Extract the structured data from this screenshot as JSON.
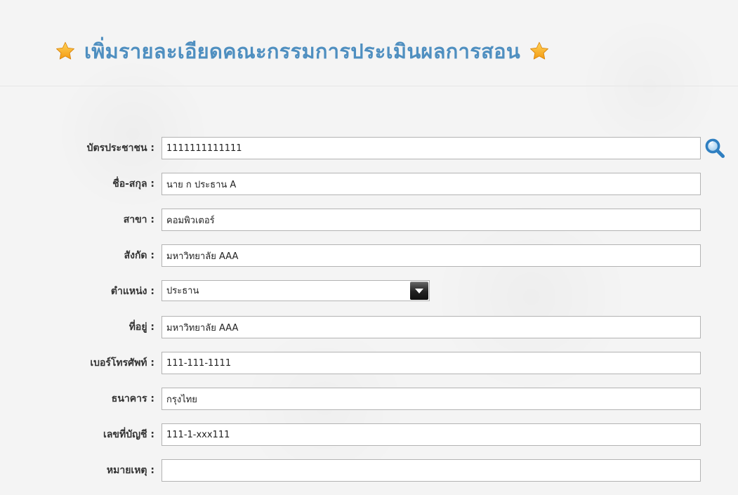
{
  "page": {
    "title": "เพิ่มรายละเอียดคณะกรรมการประเมินผลการสอน",
    "accent_color": "#4f8fc0",
    "star_color": "#f7a21b"
  },
  "form": {
    "fields": {
      "citizen_id": {
        "label": "บัตรประชาชน :",
        "value": "1111111111111"
      },
      "full_name": {
        "label": "ชื่อ-สกุล :",
        "value": "นาย ก ประธาน A"
      },
      "branch": {
        "label": "สาขา :",
        "value": "คอมพิวเตอร์"
      },
      "affiliation": {
        "label": "สังกัด :",
        "value": "มหาวิทยาลัย AAA"
      },
      "position": {
        "label": "ตำแหน่ง :",
        "value": "ประธาน"
      },
      "address": {
        "label": "ที่อยู่ :",
        "value": "มหาวิทยาลัย AAA"
      },
      "phone": {
        "label": "เบอร์โทรศัพท์ :",
        "value": "111-111-1111"
      },
      "bank": {
        "label": "ธนาคาร :",
        "value": "กรุงไทย"
      },
      "account_no": {
        "label": "เลขที่บัญชี :",
        "value": "111-1-xxx111"
      },
      "remarks": {
        "label": "หมายเหตุ :",
        "value": ""
      }
    }
  },
  "icons": {
    "title_left": "star-icon",
    "title_right": "star-icon",
    "search": "search-icon",
    "dropdown": "chevron-down-icon"
  }
}
